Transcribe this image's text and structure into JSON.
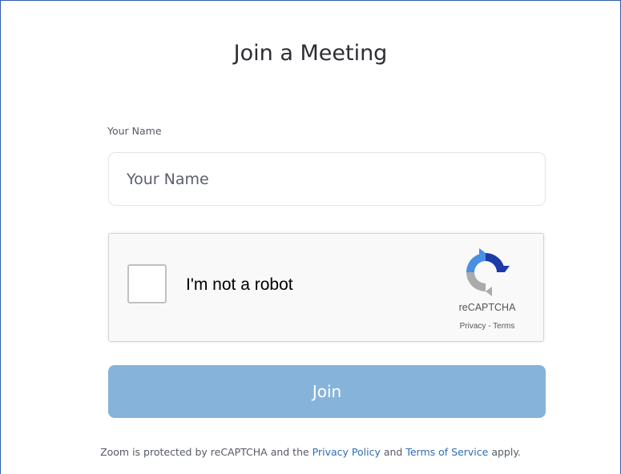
{
  "title": "Join a Meeting",
  "name_field": {
    "label": "Your Name",
    "placeholder": "Your Name",
    "value": ""
  },
  "captcha": {
    "checkbox_label": "I'm not a robot",
    "brand": "reCAPTCHA",
    "privacy_link": "Privacy",
    "separator": " - ",
    "terms_link": "Terms",
    "checked": false,
    "logo_icon": "recaptcha-logo-icon",
    "logo_colors": {
      "blue": "#4a90e2",
      "dark_blue": "#1c3aa9",
      "gray": "#ababab"
    }
  },
  "join_button": {
    "label": "Join",
    "color": "#86b3da"
  },
  "footer": {
    "prefix": "Zoom is protected by reCAPTCHA and the ",
    "privacy_link": "Privacy Policy",
    "middle": " and ",
    "terms_link": "Terms of Service",
    "suffix": " apply.",
    "link_color": "#2d6cb5"
  }
}
